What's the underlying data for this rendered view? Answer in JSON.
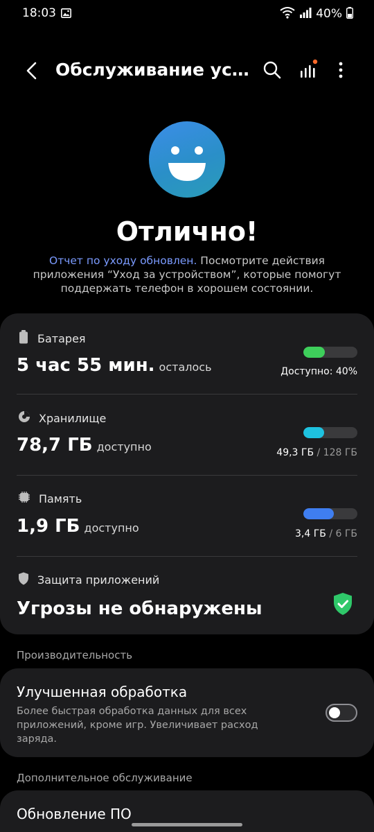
{
  "status_bar": {
    "time": "18:03",
    "battery_percent": "40%",
    "icons": [
      "gallery-icon",
      "wifi-icon",
      "signal-icon",
      "battery-icon"
    ]
  },
  "app_bar": {
    "title": "Обслуживание устр...",
    "icons": [
      "back-arrow-icon",
      "search-icon",
      "stats-icon",
      "more-vertical-icon"
    ],
    "notification_dot_color": "#ff6a2b"
  },
  "hero": {
    "status": "Отлично!",
    "description_link": "Отчет по уходу обновлен.",
    "description_rest": " Посмотрите действия приложения “Уход за устройством”, которые помогут поддержать телефон в хорошем состоянии.",
    "link_color": "#7b9bff"
  },
  "battery": {
    "label": "Батарея",
    "value": "5 час 55 мин.",
    "suffix": "осталось",
    "caption": "Доступно: 40%",
    "level_fraction": 0.4,
    "bar_color": "#3ecf5b"
  },
  "storage": {
    "label": "Хранилище",
    "value": "78,7 ГБ",
    "suffix": "доступно",
    "used": "49,3 ГБ",
    "total": "/ 128 ГБ",
    "level_fraction": 0.385,
    "bar_color": "#1ec2e0"
  },
  "memory": {
    "label": "Память",
    "value": "1,9 ГБ",
    "suffix": "доступно",
    "used": "3,4 ГБ",
    "total": "/ 6 ГБ",
    "level_fraction": 0.567,
    "bar_color": "#3f7ef0"
  },
  "protection": {
    "label": "Защита приложений",
    "value": "Угрозы не обнаружены",
    "shield_color": "#2fc86a"
  },
  "performance": {
    "section_label": "Производительность",
    "title": "Улучшенная обработка",
    "description": "Более быстрая обработка данных для всех приложений, кроме игр. Увеличивает расход заряда.",
    "enabled": false
  },
  "additional": {
    "section_label": "Дополнительное обслуживание",
    "update_title": "Обновление ПО"
  }
}
